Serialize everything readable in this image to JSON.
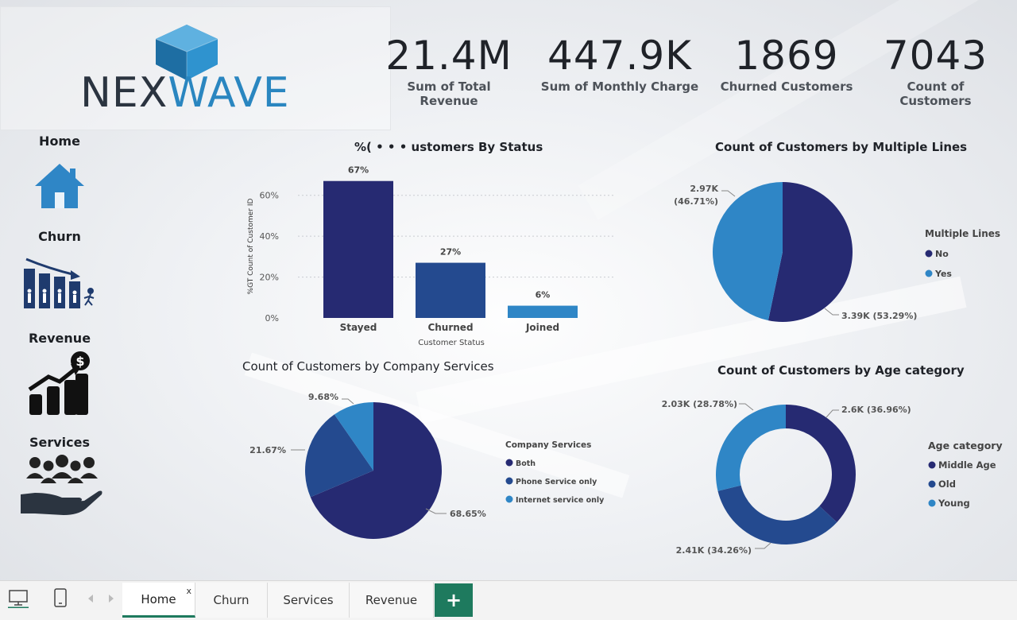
{
  "logo": {
    "part1": "NEX",
    "part2": "WAVE"
  },
  "kpis": [
    {
      "value": "21.4M",
      "label": "Sum of Total Revenue"
    },
    {
      "value": "447.9K",
      "label": "Sum of Monthly Charge"
    },
    {
      "value": "1869",
      "label": "Churned Customers"
    },
    {
      "value": "7043",
      "label": "Count of Customers"
    }
  ],
  "nav": [
    {
      "label": "Home",
      "icon": "house-icon"
    },
    {
      "label": "Churn",
      "icon": "churn-bars-icon"
    },
    {
      "label": "Revenue",
      "icon": "revenue-growth-icon"
    },
    {
      "label": "Services",
      "icon": "people-hand-icon"
    }
  ],
  "charts": {
    "status": {
      "title": "%( • • • ustomers By Status",
      "xlabel": "Customer Status",
      "ylabel": "%GT Count of Customer ID"
    },
    "multiple_lines": {
      "title": "Count of Customers by Multiple Lines",
      "legend_title": "Multiple Lines",
      "labels": [
        "3.39K (53.29%)",
        "2.97K",
        "(46.71%)"
      ]
    },
    "services": {
      "title": "Count of Customers by Company Services",
      "legend_title": "Company Services",
      "labels": [
        "68.65%",
        "21.67%",
        "9.68%"
      ]
    },
    "age": {
      "title": "Count of Customers by Age category",
      "legend_title": "Age category",
      "labels": [
        "2.6K (36.96%)",
        "2.41K (34.26%)",
        "2.03K (28.78%)"
      ]
    }
  },
  "chart_data": [
    {
      "type": "bar",
      "title": "%( • • • ustomers By Status",
      "xlabel": "Customer Status",
      "ylabel": "%GT Count of Customer ID",
      "categories": [
        "Stayed",
        "Churned",
        "Joined"
      ],
      "values": [
        67,
        27,
        6
      ],
      "data_labels": [
        "67%",
        "27%",
        "6%"
      ],
      "y_ticks": [
        "0%",
        "20%",
        "40%",
        "60%"
      ],
      "ylim": [
        0,
        70
      ],
      "colors": [
        "#262a72",
        "#244a8f",
        "#2f86c6"
      ],
      "grid": true
    },
    {
      "type": "pie",
      "title": "Count of Customers by Multiple Lines",
      "legend_title": "Multiple Lines",
      "categories": [
        "No",
        "Yes"
      ],
      "values": [
        53.29,
        46.71
      ],
      "counts": [
        "3.39K",
        "2.97K"
      ],
      "colors": [
        "#262a72",
        "#2f86c6"
      ],
      "legend": "right"
    },
    {
      "type": "pie",
      "title": "Count of Customers by Company Services",
      "legend_title": "Company Services",
      "categories": [
        "Both",
        "Phone Service only",
        "Internet service only"
      ],
      "values": [
        68.65,
        21.67,
        9.68
      ],
      "colors": [
        "#262a72",
        "#244a8f",
        "#2f86c6"
      ],
      "legend": "right"
    },
    {
      "type": "pie",
      "title": "Count of Customers by Age category",
      "legend_title": "Age category",
      "categories": [
        "Middle Age",
        "Old",
        "Young"
      ],
      "values": [
        36.96,
        34.26,
        28.78
      ],
      "counts": [
        "2.6K",
        "2.41K",
        "2.03K"
      ],
      "colors": [
        "#262a72",
        "#244a8f",
        "#2f86c6"
      ],
      "legend": "right",
      "donut": true
    }
  ],
  "tabs": [
    {
      "label": "Home",
      "close": "x"
    },
    {
      "label": "Churn"
    },
    {
      "label": "Services"
    },
    {
      "label": "Revenue"
    }
  ],
  "add_tab_label": "+",
  "colors": {
    "navy": "#262a72",
    "mid_blue": "#244a8f",
    "light_blue": "#2f86c6",
    "accent_green": "#1e7a5e"
  }
}
